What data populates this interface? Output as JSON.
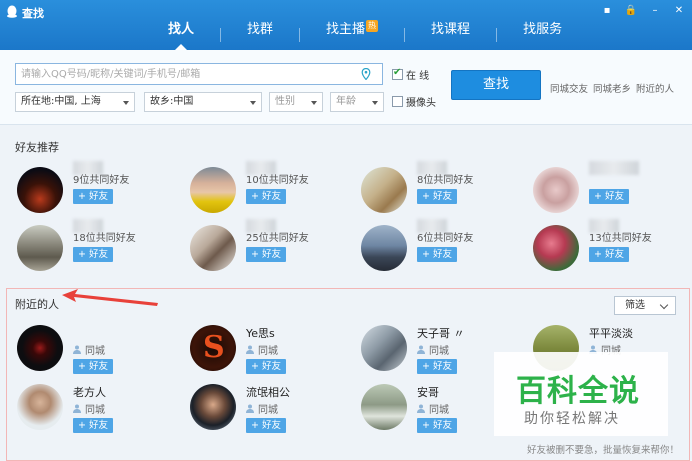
{
  "window": {
    "title": "查找"
  },
  "tabs": [
    {
      "label": "找人",
      "active": true
    },
    {
      "label": "找群"
    },
    {
      "label": "找主播",
      "badge": "热"
    },
    {
      "label": "找课程"
    },
    {
      "label": "找服务"
    }
  ],
  "search": {
    "placeholder": "请输入QQ号码/昵称/关键词/手机号/邮箱",
    "online_label": "在 线",
    "online_checked": true,
    "camera_label": "摄像头",
    "camera_checked": false,
    "button_label": "查找",
    "quick_links": [
      "同城交友",
      "同城老乡",
      "附近的人"
    ],
    "filters": {
      "location": "所在地:中国, 上海",
      "hometown": "故乡:中国",
      "gender": "性别",
      "age": "年龄"
    }
  },
  "recommend": {
    "title": "好友推荐",
    "add_label": "+ 好友",
    "cards": [
      {
        "mutual": "9位共同好友"
      },
      {
        "mutual": "10位共同好友"
      },
      {
        "mutual": "8位共同好友"
      },
      {
        "mutual": ""
      },
      {
        "mutual": "18位共同好友"
      },
      {
        "mutual": "25位共同好友"
      },
      {
        "mutual": "6位共同好友"
      },
      {
        "mutual": "13位共同好友"
      }
    ]
  },
  "nearby": {
    "title": "附近的人",
    "filter_label": "筛选",
    "add_label": "+ 好友",
    "loc_label": "同城",
    "people": [
      {
        "name": ""
      },
      {
        "name": "Ye思s"
      },
      {
        "name": "天子哥 〃"
      },
      {
        "name": "平平淡淡"
      },
      {
        "name": "老方人"
      },
      {
        "name": "流氓相公"
      },
      {
        "name": "安哥"
      }
    ]
  },
  "watermark": {
    "main": "百科全说",
    "sub": "助你轻松解决"
  },
  "bottom_note": "好友被删不要急，批量恢复来帮你！",
  "colors": {
    "titlebar": "#1e83d3",
    "accent": "#1e8de0",
    "add_button": "#4ea5e6",
    "watermark": "#2db24a"
  }
}
